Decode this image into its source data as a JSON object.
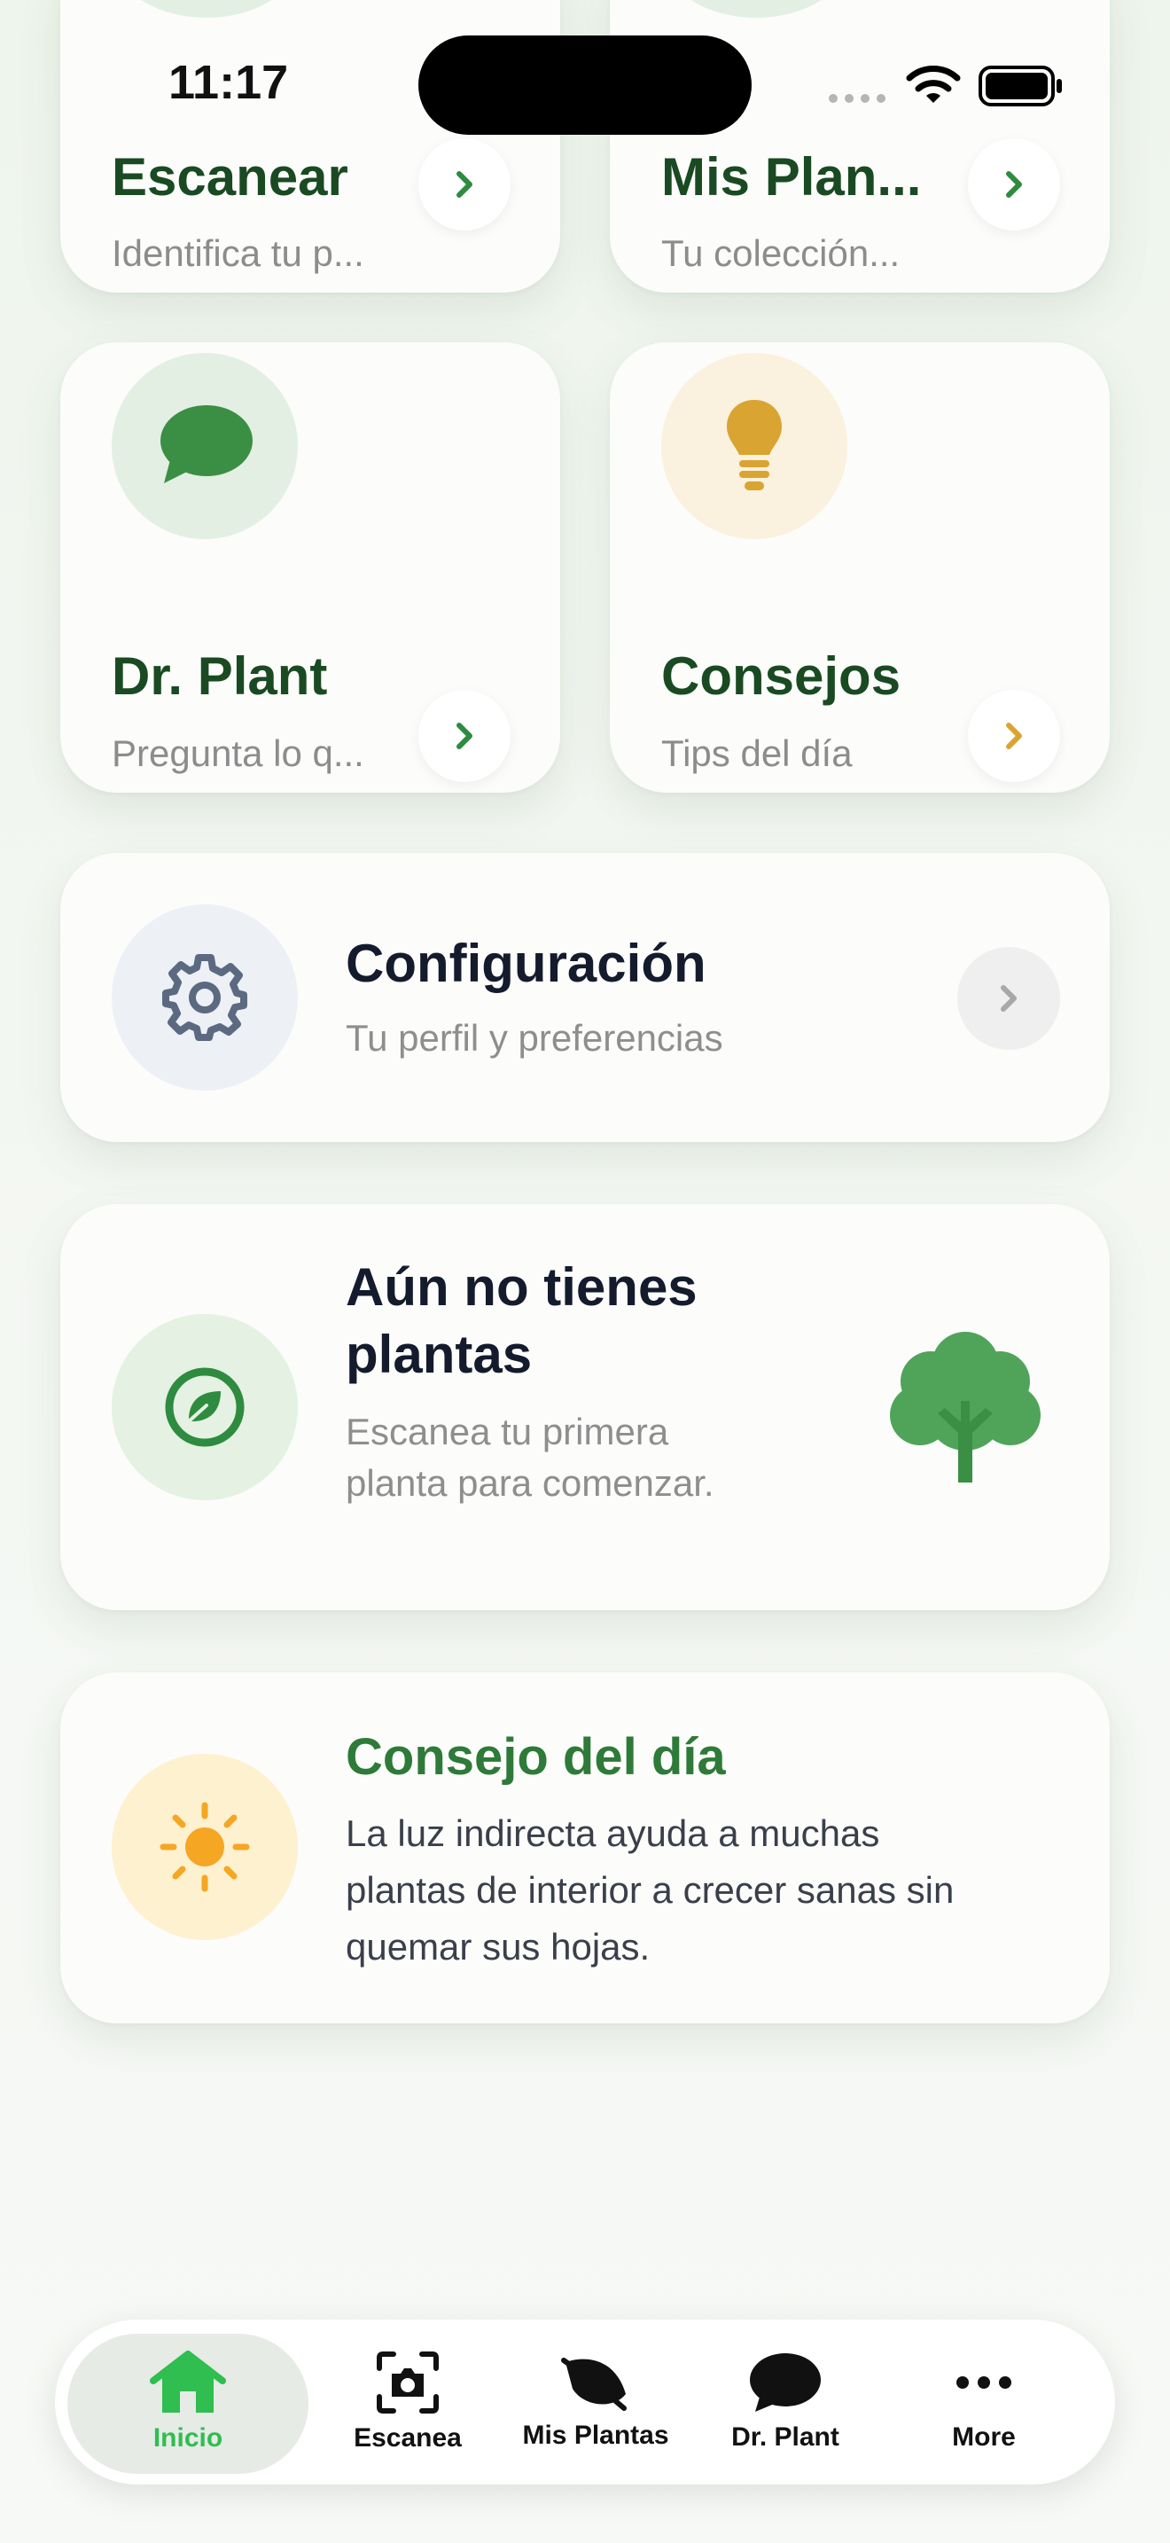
{
  "status_bar": {
    "time": "11:17"
  },
  "tiles": {
    "scan": {
      "title": "Escanear",
      "subtitle": "Identifica tu p..."
    },
    "my_plants": {
      "title": "Mis Plan...",
      "subtitle": "Tu colección..."
    },
    "dr_plant": {
      "title": "Dr. Plant",
      "subtitle": "Pregunta lo q..."
    },
    "tips": {
      "title": "Consejos",
      "subtitle": "Tips del día"
    }
  },
  "settings_row": {
    "title": "Configuración",
    "subtitle": "Tu perfil y preferencias"
  },
  "empty_plants": {
    "title": "Aún no tienes plantas",
    "subtitle": "Escanea tu primera planta para comenzar."
  },
  "daily_tip": {
    "title": "Consejo del día",
    "body": "La luz indirecta ayuda a muchas plantas de interior a crecer sanas sin quemar sus hojas."
  },
  "tab_bar": {
    "items": [
      {
        "label": "Inicio",
        "icon": "house-icon",
        "active": true
      },
      {
        "label": "Escanea",
        "icon": "camera-scan-icon",
        "active": false
      },
      {
        "label": "Mis Plantas",
        "icon": "leaf-icon",
        "active": false
      },
      {
        "label": "Dr. Plant",
        "icon": "chat-bubble-icon",
        "active": false
      },
      {
        "label": "More",
        "icon": "ellipsis-icon",
        "active": false
      }
    ]
  },
  "colors": {
    "accent_green": "#2e8b3f",
    "title_green": "#1a4a22",
    "tab_active": "#2fbe4f",
    "gold": "#d9a431",
    "sun": "#f5a623"
  }
}
